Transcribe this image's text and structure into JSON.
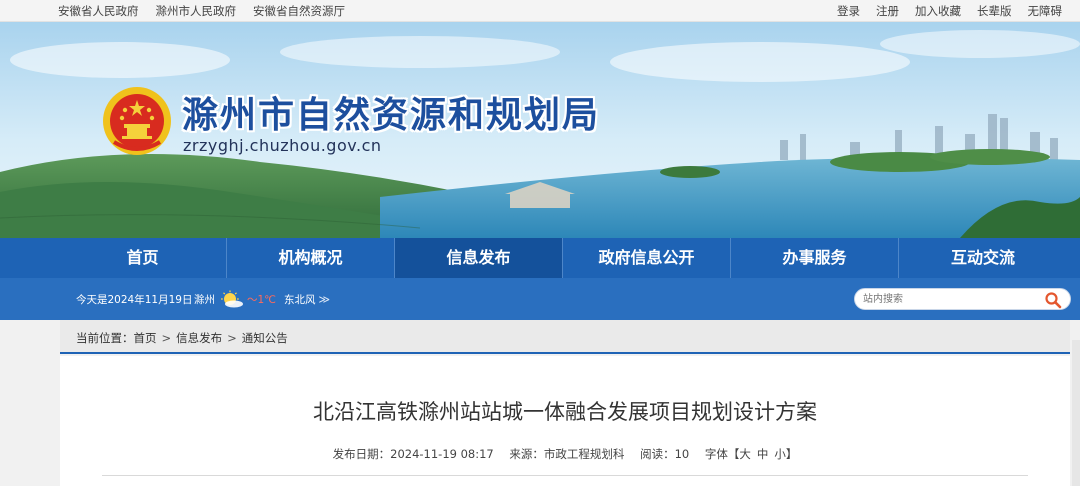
{
  "topbar": {
    "left_links": [
      "安徽省人民政府",
      "滁州市人民政府",
      "安徽省自然资源厅"
    ],
    "right_links": [
      "登录",
      "注册",
      "加入收藏",
      "长辈版",
      "无障碍"
    ]
  },
  "banner": {
    "site_title": "滁州市自然资源和规划局",
    "domain": "zrzyghj.chuzhou.gov.cn"
  },
  "nav": {
    "items": [
      "首页",
      "机构概况",
      "信息发布",
      "政府信息公开",
      "办事服务",
      "互动交流"
    ],
    "active": "信息发布"
  },
  "infobar": {
    "date": "今天是2024年11月19日",
    "city": "滁州",
    "temp": "～1℃",
    "wind": "东北风",
    "more": "≫"
  },
  "search": {
    "placeholder": "站内搜索"
  },
  "breadcrumb": {
    "prefix": "当前位置：",
    "items": [
      "首页",
      "信息发布",
      "通知公告"
    ],
    "sep": ">"
  },
  "article": {
    "title": "北沿江高铁滁州站站城一体融合发展项目规划设计方案",
    "date_label": "发布日期：2024-11-19 08:17",
    "source_label": "来源：市政工程规划科",
    "reads_label": "阅读：",
    "reads_value": "10",
    "font_label": "字体【",
    "font_big": "大",
    "font_mid": "中",
    "font_small": "小",
    "font_end": "】"
  },
  "colors": {
    "nav_bg": "#1e63b5",
    "nav_active": "#14519b",
    "infobar_bg": "#2a6fbf",
    "title_blue": "#1d4f9e"
  }
}
